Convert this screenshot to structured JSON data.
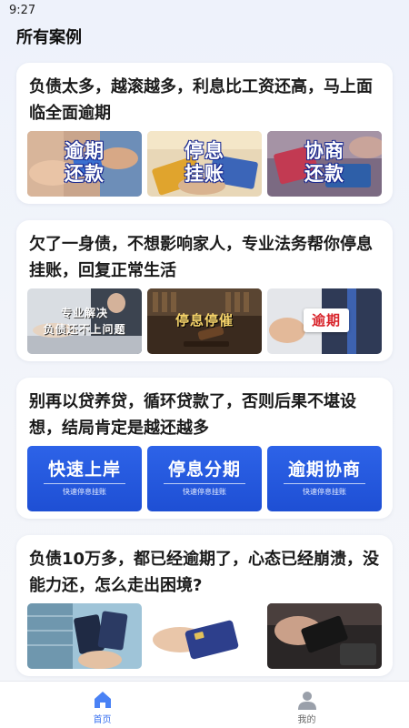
{
  "status_bar": {
    "time": "9:27"
  },
  "header": {
    "title": "所有案例"
  },
  "cards": [
    {
      "title": "负债太多，越滚越多，利息比工资还高，马上面临全面逾期",
      "images": [
        {
          "icon": "hands-card-photo",
          "caption_line1": "逾期",
          "caption_line2": "还款"
        },
        {
          "icon": "credit-card-photo",
          "caption_line1": "停息",
          "caption_line2": "挂账"
        },
        {
          "icon": "card-wallet-photo",
          "caption_line1": "协商",
          "caption_line2": "还款"
        }
      ]
    },
    {
      "title": "欠了一身债，不想影响家人，专业法务帮你停息挂账，回复正常生活",
      "images": [
        {
          "icon": "office-meeting-photo",
          "caption_line1": "专业解决",
          "caption_line2": "负债还不上问题"
        },
        {
          "icon": "courtroom-gavel-photo",
          "caption": "停息停催"
        },
        {
          "icon": "businessman-hand-photo",
          "caption": "逾期"
        }
      ]
    },
    {
      "title": "别再以贷养贷，循环贷款了，否则后果不堪设想，结局肯定是越还越多",
      "buttons": [
        {
          "label": "快速上岸",
          "sub": "快速停息挂账"
        },
        {
          "label": "停息分期",
          "sub": "快速停息挂账"
        },
        {
          "label": "逾期协商",
          "sub": "快速停息挂账"
        }
      ]
    },
    {
      "title": "负债10万多，都已经逾期了，心态已经崩溃，没能力还，怎么走出困境?",
      "images": [
        {
          "icon": "building-cards-photo"
        },
        {
          "icon": "hand-credit-card-photo"
        },
        {
          "icon": "card-reader-photo"
        }
      ]
    }
  ],
  "tab_bar": {
    "home": {
      "label": "首页",
      "icon": "home-icon"
    },
    "mine": {
      "label": "我的",
      "icon": "user-icon"
    }
  },
  "colors": {
    "accent": "#3a72f0",
    "button_blue": "#2458de",
    "background": "#f3f5fa"
  }
}
